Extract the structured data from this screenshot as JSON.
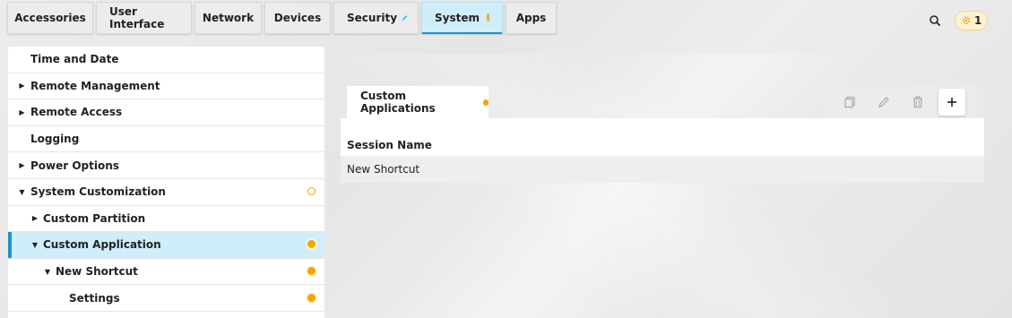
{
  "top_tabs": [
    {
      "label": "Accessories"
    },
    {
      "label": "User Interface"
    },
    {
      "label": "Network"
    },
    {
      "label": "Devices"
    },
    {
      "label": "Security"
    },
    {
      "label": "System"
    },
    {
      "label": "Apps"
    }
  ],
  "active_tab": "System",
  "notifications": {
    "count": "1"
  },
  "sidebar": {
    "items": [
      {
        "label": "Time and Date"
      },
      {
        "label": "Remote Management"
      },
      {
        "label": "Remote Access"
      },
      {
        "label": "Logging"
      },
      {
        "label": "Power Options"
      },
      {
        "label": "System Customization"
      },
      {
        "label": "Custom Partition"
      },
      {
        "label": "Custom Application"
      },
      {
        "label": "New Shortcut"
      },
      {
        "label": "Settings"
      }
    ],
    "selected": "Custom Application"
  },
  "content": {
    "tab_label": "Custom Applications",
    "table": {
      "columns": [
        "Session Name"
      ],
      "rows": [
        [
          "New Shortcut"
        ]
      ]
    }
  },
  "colors": {
    "accent": "#1a96c9",
    "status_orange": "#f0a500",
    "selected_bg": "#cfeefa"
  },
  "icons": {
    "search": "search-icon",
    "notification": "gear-notification-icon",
    "copy": "copy-icon",
    "edit": "pencil-icon",
    "delete": "trash-icon",
    "add": "plus-icon"
  }
}
